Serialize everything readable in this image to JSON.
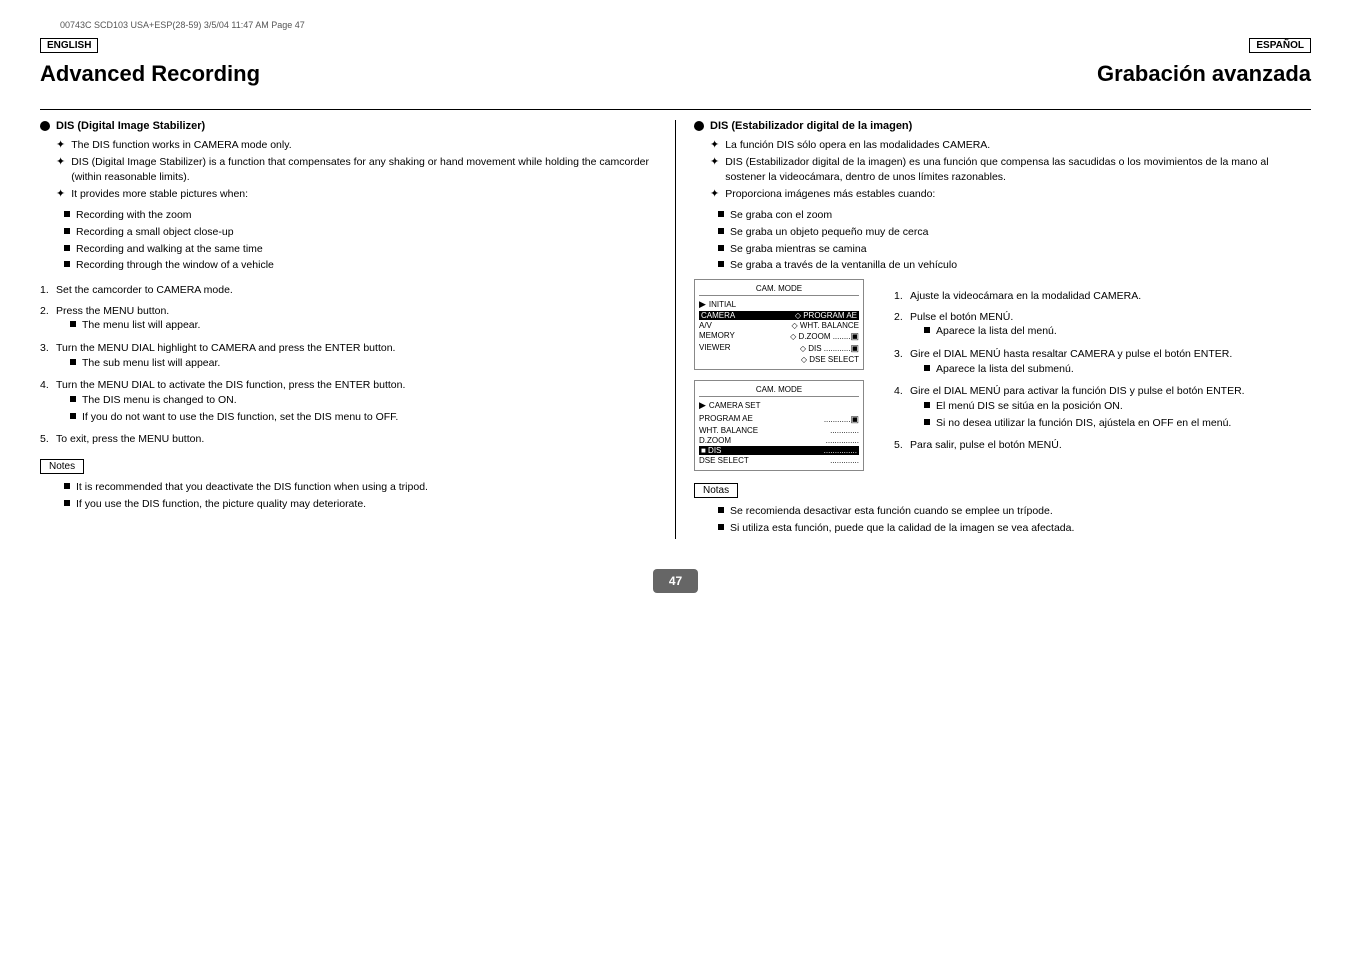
{
  "file_info": "00743C SCD103 USA+ESP(28-59)   3/5/04 11:47 AM   Page 47",
  "english": {
    "lang_label": "ENGLISH",
    "page_title": "Advanced Recording",
    "dis_heading": "DIS (Digital Image Stabilizer)",
    "dis_items": [
      "The DIS function works in CAMERA mode only.",
      "DIS (Digital Image Stabilizer) is a function that compensates for any shaking or hand movement while holding the camcorder (within reasonable limits).",
      "It provides more stable pictures when:"
    ],
    "stable_list": [
      "Recording with the zoom",
      "Recording a small object close-up",
      "Recording and walking at the same time",
      "Recording through the window of a vehicle"
    ],
    "steps": [
      {
        "num": "1.",
        "text": "Set the camcorder to CAMERA mode."
      },
      {
        "num": "2.",
        "text": "Press the MENU button.",
        "sub": [
          "The menu list will appear."
        ]
      },
      {
        "num": "3.",
        "text": "Turn the MENU DIAL highlight to CAMERA and press the ENTER button.",
        "sub": [
          "The sub menu list will appear."
        ]
      },
      {
        "num": "4.",
        "text": "Turn the MENU DIAL to activate the DIS function, press the ENTER button.",
        "sub": [
          "The DIS menu is changed to ON.",
          "If you do not want to use the DIS function, set the DIS menu to OFF."
        ]
      },
      {
        "num": "5.",
        "text": "To exit, press the MENU button."
      }
    ],
    "notes_label": "Notes",
    "notes": [
      "It is recommended that you deactivate the DIS function when using a tripod.",
      "If you use the DIS function, the picture quality may deteriorate."
    ]
  },
  "spanish": {
    "lang_label": "ESPAÑOL",
    "page_title": "Grabación avanzada",
    "dis_heading": "DIS (Estabilizador digital de la imagen)",
    "dis_items": [
      "La función DIS sólo opera en las modalidades CAMERA.",
      "DIS (Estabilizador digital de la imagen) es una función que compensa las sacudidas o los movimientos de la mano al sostener la videocámara, dentro de unos límites razonables.",
      "Proporciona imágenes más estables cuando:"
    ],
    "stable_list": [
      "Se graba con el zoom",
      "Se graba un objeto pequeño muy de cerca",
      "Se graba mientras se camina",
      "Se graba a través de la ventanilla de un vehículo"
    ],
    "steps": [
      {
        "num": "1.",
        "text": "Ajuste la videocámara en la modalidad CAMERA."
      },
      {
        "num": "2.",
        "text": "Pulse el botón MENÚ.",
        "sub": [
          "Aparece la lista del menú."
        ]
      },
      {
        "num": "3.",
        "text": "Gire el DIAL MENÚ hasta resaltar CAMERA y pulse el botón ENTER.",
        "sub": [
          "Aparece la lista del submenú."
        ]
      },
      {
        "num": "4.",
        "text": "Gire el DIAL MENÚ para activar la función DIS y pulse el botón ENTER.",
        "sub": [
          "El menú DIS se sitúa en la posición ON.",
          "Si no desea utilizar la función DIS, ajústela en OFF en el menú."
        ]
      },
      {
        "num": "5.",
        "text": "Para salir, pulse el botón MENÚ."
      }
    ],
    "notes_label": "Notas",
    "notes": [
      "Se recomienda desactivar esta función cuando se emplee un trípode.",
      "Si utiliza esta función, puede que la calidad de la imagen se vea afectada."
    ]
  },
  "diagrams": {
    "diagram1": {
      "title": "CAM. MODE",
      "rows": [
        {
          "label": "INITIAL",
          "value": "",
          "selected": false,
          "indicator": true
        },
        {
          "label": "CAMERA",
          "value": "◇ PROGRAM AE",
          "selected": false,
          "indicator": false
        },
        {
          "label": "A/V",
          "value": "◇ WHT. BALANCE",
          "selected": false,
          "indicator": false
        },
        {
          "label": "MEMORY",
          "value": "◇ D.ZOOM .............",
          "selected": false,
          "indicator": false
        },
        {
          "label": "VIEWER",
          "value": "◇ DIS ...................",
          "selected": false,
          "indicator": false
        },
        {
          "label": "",
          "value": "◇ DSE SELECT",
          "selected": false,
          "indicator": false
        }
      ]
    },
    "diagram2": {
      "title": "CAM. MODE",
      "subtitle": "CAMERA SET",
      "rows": [
        {
          "label": "PROGRAM AE",
          "value": "..................▣",
          "selected": false
        },
        {
          "label": "WHT. BALANCE",
          "value": ".................",
          "selected": false
        },
        {
          "label": "D.ZOOM",
          "value": "..................",
          "selected": false
        },
        {
          "label": "DIS",
          "value": "■ ...................",
          "selected": true
        },
        {
          "label": "DSE SELECT",
          "value": "..................",
          "selected": false
        }
      ]
    }
  },
  "page_number": "47"
}
